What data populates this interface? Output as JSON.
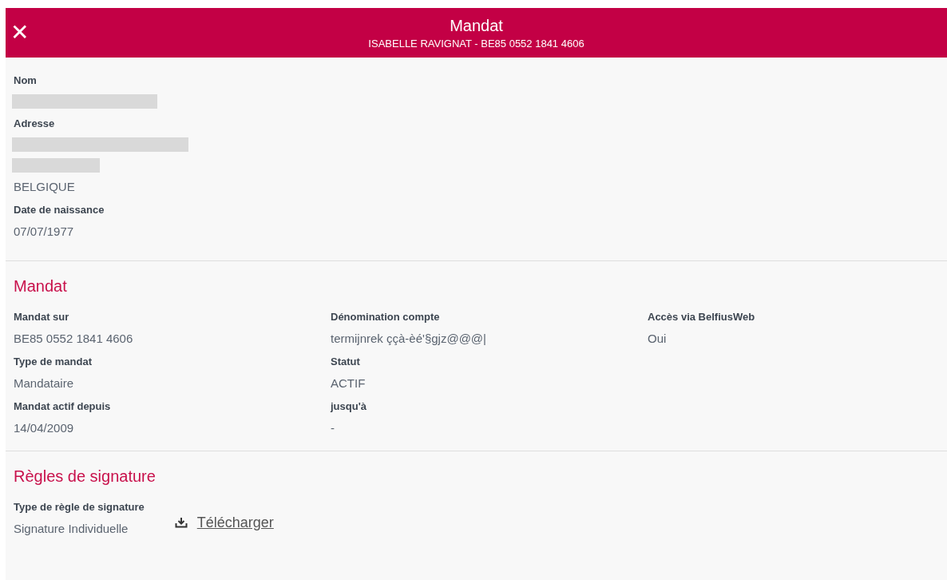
{
  "header": {
    "close_icon": "✕",
    "title": "Mandat",
    "subtitle": "ISABELLE RAVIGNAT - BE85 0552 1841 4606"
  },
  "person": [
    {
      "label": "Nom",
      "values": [
        {
          "kind": "redacted"
        }
      ]
    },
    {
      "label": "Adresse",
      "values": [
        {
          "kind": "redacted"
        },
        {
          "kind": "redacted"
        },
        {
          "kind": "text",
          "text": "BELGIQUE"
        }
      ]
    },
    {
      "label": "Date de naissance",
      "values": [
        {
          "kind": "text",
          "text": "07/07/1977"
        }
      ]
    }
  ],
  "mandat": {
    "title": "Mandat",
    "rows": [
      [
        {
          "label": "Mandat sur",
          "value": "BE85 0552 1841 4606"
        },
        {
          "label": "Dénomination compte",
          "value": "termijnrek ççà-èé'§gjz@@@|"
        },
        {
          "label": "Accès via BelfiusWeb",
          "value": "Oui"
        }
      ],
      [
        {
          "label": "Type de mandat",
          "value": "Mandataire"
        },
        {
          "label": "Statut",
          "value": "ACTIF"
        }
      ],
      [
        {
          "label": "Mandat actif depuis",
          "value": "14/04/2009"
        },
        {
          "label": "jusqu'à",
          "value": "-"
        }
      ]
    ]
  },
  "signature": {
    "title": "Règles de signature",
    "label": "Type de règle de signature",
    "value": "Signature Individuelle",
    "download": "Télécharger"
  }
}
